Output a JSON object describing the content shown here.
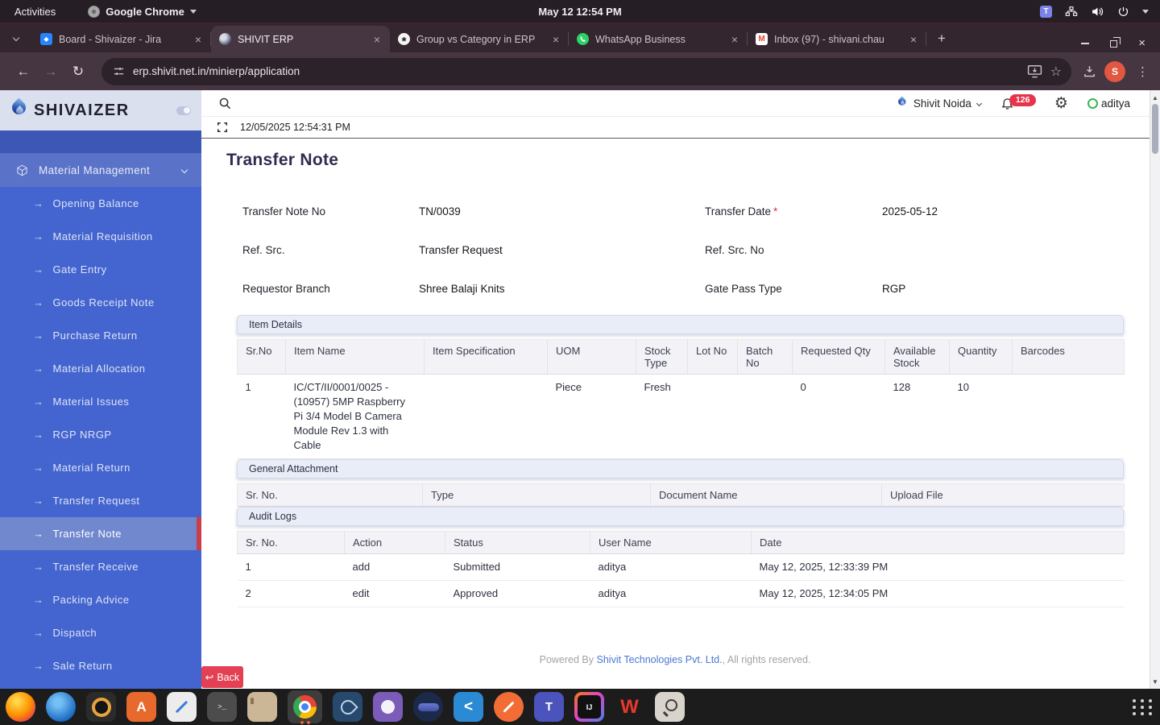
{
  "colors": {
    "sidebar_blue": "#4465d0",
    "sidebar_active": "#7187ce",
    "active_border_red": "#c73e4c",
    "back_button_red": "#e34054",
    "badge_red": "#e5344b",
    "footer_link_blue": "#4a77d4",
    "section_header_bg": "#e9edf8"
  },
  "system_bar": {
    "activities_label": "Activities",
    "app_name": "Google Chrome",
    "clock": "May 12  12:54 PM",
    "tray_icons": [
      "teams-icon",
      "network-icon",
      "volume-icon",
      "power-icon",
      "chevron-down-icon"
    ]
  },
  "browser": {
    "tabs": [
      {
        "title": "Board - Shivaizer - Jira",
        "favicon": "jira-icon",
        "active": false
      },
      {
        "title": "SHIVIT ERP",
        "favicon": "shivit-icon",
        "active": true
      },
      {
        "title": "Group vs Category in ERP",
        "favicon": "chatgpt-icon",
        "active": false
      },
      {
        "title": "WhatsApp Business",
        "favicon": "whatsapp-icon",
        "active": false
      },
      {
        "title": "Inbox (97) - shivani.chau",
        "favicon": "gmail-icon",
        "active": false
      }
    ],
    "close_glyph": "×",
    "new_tab_label": "+",
    "url": "erp.shivit.net.in/minierp/application",
    "profile_initial": "S"
  },
  "erp": {
    "brand": "SHIVAIZER",
    "topbar": {
      "branch": "Shivit Noida",
      "notification_count": "126",
      "username": "aditya"
    },
    "timestamp": "12/05/2025 12:54:31 PM",
    "sidebar": {
      "section_label": "Material Management",
      "items": [
        "Opening Balance",
        "Material Requisition",
        "Gate Entry",
        "Goods Receipt Note",
        "Purchase Return",
        "Material Allocation",
        "Material Issues",
        "RGP NRGP",
        "Material Return",
        "Transfer Request",
        "Transfer Note",
        "Transfer Receive",
        "Packing Advice",
        "Dispatch",
        "Sale Return"
      ],
      "active_item": "Transfer Note",
      "item_arrow": "→"
    },
    "page": {
      "title": "Transfer Note",
      "form": {
        "rows": [
          {
            "l1": "Transfer Note No",
            "v1": "TN/0039",
            "l2": "Transfer Date",
            "req2": "*",
            "v2": "2025-05-12"
          },
          {
            "l1": "Ref. Src.",
            "v1": "Transfer Request",
            "l2": "Ref. Src. No",
            "v2": ""
          },
          {
            "l1": "Requestor Branch",
            "v1": "Shree Balaji Knits",
            "l2": "Gate Pass Type",
            "v2": "RGP"
          }
        ]
      },
      "item_details": {
        "title": "Item Details",
        "columns": [
          "Sr.No",
          "Item Name",
          "Item Specification",
          "UOM",
          "Stock Type",
          "Lot No",
          "Batch No",
          "Requested Qty",
          "Available Stock",
          "Quantity",
          "Barcodes"
        ],
        "rows": [
          [
            "1",
            "IC/CT/II/0001/0025 - (10957) 5MP Raspberry Pi 3/4 Model B Camera Module Rev 1.3 with Cable",
            "",
            "Piece",
            "Fresh",
            "",
            "",
            "0",
            "128",
            "10",
            ""
          ]
        ]
      },
      "general_attachment": {
        "title": "General Attachment",
        "columns": [
          "Sr. No.",
          "Type",
          "Document Name",
          "Upload File"
        ],
        "rows": []
      },
      "audit_logs": {
        "title": "Audit Logs",
        "columns": [
          "Sr. No.",
          "Action",
          "Status",
          "User Name",
          "Date"
        ],
        "rows": [
          [
            "1",
            "add",
            "Submitted",
            "aditya",
            "May 12, 2025, 12:33:39 PM"
          ],
          [
            "2",
            "edit",
            "Approved",
            "aditya",
            "May 12, 2025, 12:34:05 PM"
          ]
        ]
      },
      "back_label": "Back",
      "back_arrow": "↩",
      "footer": {
        "powered_by": "Powered By",
        "company": "Shivit Technologies Pvt. Ltd.",
        "rights": ", All rights reserved."
      }
    }
  },
  "dock": {
    "icons": [
      "firefox",
      "thunderbird",
      "media-player",
      "ubuntu-software",
      "text-editor",
      "terminal",
      "files",
      "google-chrome",
      "sql-developer",
      "github-desktop",
      "eclipse",
      "vscode",
      "pen-tool",
      "teams",
      "intellij-idea",
      "wps-office",
      "screenshot-tool",
      "show-applications"
    ]
  }
}
